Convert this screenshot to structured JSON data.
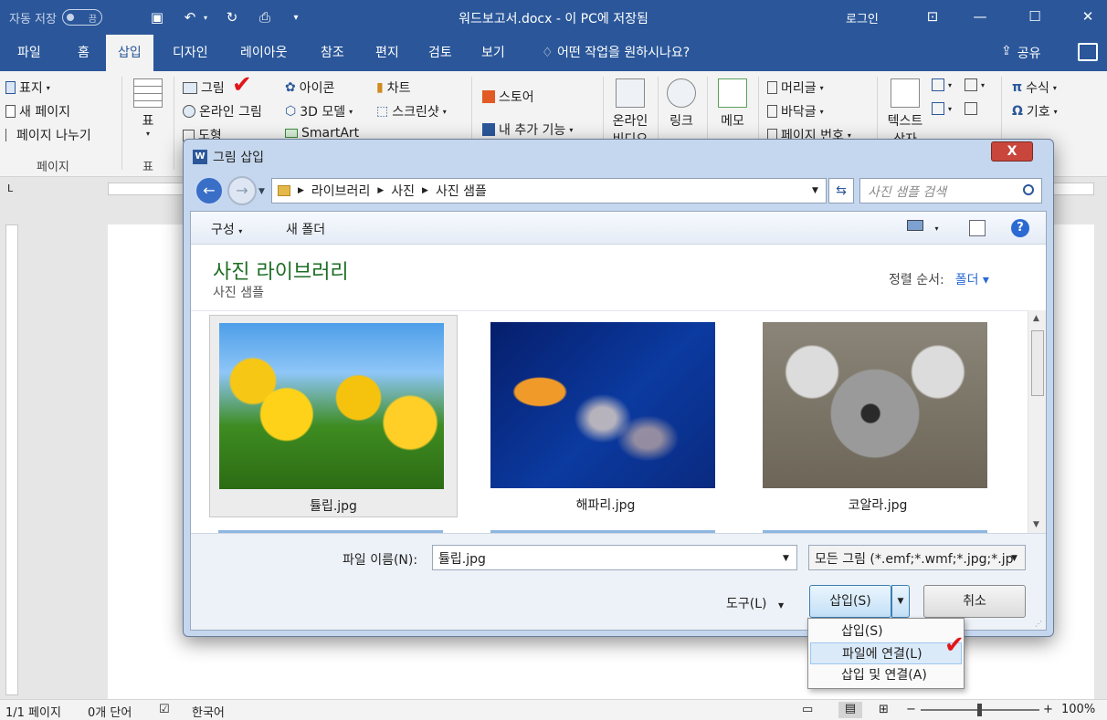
{
  "titlebar": {
    "autosave_label": "자동 저장",
    "autosave_state": "끔",
    "document_title": "워드보고서.docx  -  이 PC에 저장됨",
    "login": "로그인"
  },
  "tabs": [
    {
      "label": "파일"
    },
    {
      "label": "홈"
    },
    {
      "label": "삽입"
    },
    {
      "label": "디자인"
    },
    {
      "label": "레이아웃"
    },
    {
      "label": "참조"
    },
    {
      "label": "편지"
    },
    {
      "label": "검토"
    },
    {
      "label": "보기"
    },
    {
      "label": "어떤 작업을 원하시나요?"
    }
  ],
  "share_label": "공유",
  "ribbon": {
    "pages": {
      "cover": "표지",
      "new_page": "새 페이지",
      "page_break": "페이지 나누기",
      "group": "페이지"
    },
    "table": {
      "label": "표",
      "group": "표"
    },
    "illustrations": {
      "picture": "그림",
      "online_picture": "온라인 그림",
      "shapes": "도형",
      "icons": "아이콘",
      "model3d": "3D 모델",
      "smartart": "SmartArt",
      "chart": "차트",
      "screenshot": "스크린샷"
    },
    "addins": {
      "store": "스토어",
      "my_addins": "내 추가 기능"
    },
    "media": {
      "online_video_1": "온라인",
      "online_video_2": "비디오"
    },
    "links": {
      "link": "링크"
    },
    "comments": {
      "memo": "메모"
    },
    "header_footer": {
      "header": "머리글",
      "footer": "바닥글",
      "page_number": "페이지 번호"
    },
    "text": {
      "textbox_1": "텍스트",
      "textbox_2": "상자"
    },
    "symbols": {
      "equation": "수식",
      "symbol": "기호"
    }
  },
  "status": {
    "page": "1/1 페이지",
    "words": "0개 단어",
    "language": "한국어",
    "zoom": "100%"
  },
  "dialog": {
    "title": "그림 삽입",
    "breadcrumb": [
      "라이브러리",
      "사진",
      "사진 샘플"
    ],
    "search_placeholder": "사진 샘플 검색",
    "organize": "구성",
    "new_folder": "새 폴더",
    "library_title": "사진 라이브러리",
    "library_subtitle": "사진 샘플",
    "sort_label": "정렬 순서:",
    "sort_value": "폴더",
    "files": [
      {
        "name": "튤립.jpg"
      },
      {
        "name": "해파리.jpg"
      },
      {
        "name": "코알라.jpg"
      }
    ],
    "filename_label": "파일 이름(N):",
    "filename_value": "튤립.jpg",
    "filter": "모든 그림 (*.emf;*.wmf;*.jpg;*.jp",
    "tools": "도구(L)",
    "insert": "삽입(S)",
    "cancel": "취소"
  },
  "insert_menu": [
    {
      "label": "삽입(S)"
    },
    {
      "label": "파일에 연결(L)"
    },
    {
      "label": "삽입 및 연결(A)"
    }
  ],
  "colors": {
    "accent": "#2b579a",
    "check": "#e1161b",
    "library_title": "#1c6e24"
  }
}
